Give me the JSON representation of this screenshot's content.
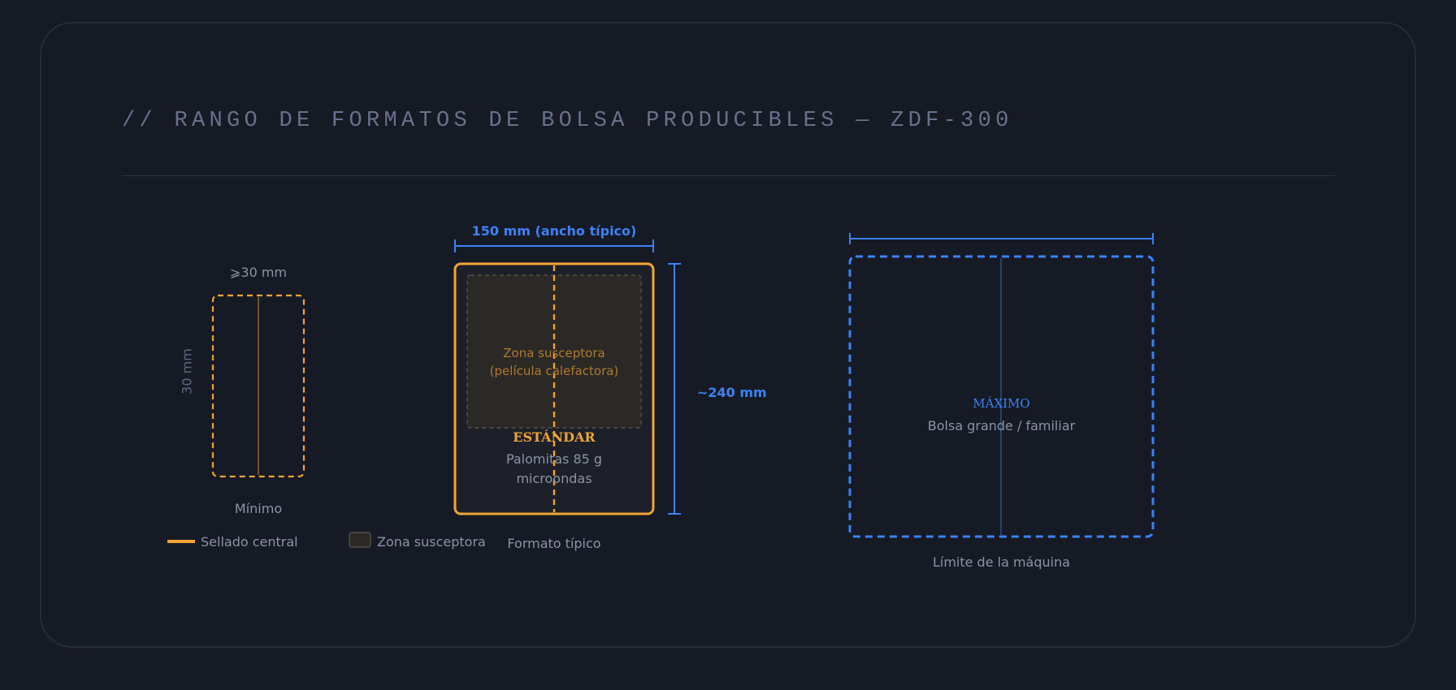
{
  "title": "// RANGO DE FORMATOS DE BOLSA PRODUCIBLES — ZDF-300",
  "minimum": {
    "width_label": "⩾30 mm",
    "height_label": "30 mm",
    "caption": "Mínimo"
  },
  "standard": {
    "width_label": "150 mm (ancho típico)",
    "height_label": "~240 mm",
    "zone_line1": "Zona susceptora",
    "zone_line2": "(película calefactora)",
    "tag": "ESTÁNDAR",
    "desc_line1": "Palomitas 85 g",
    "desc_line2": "microondas",
    "caption": "Formato típico"
  },
  "maximum": {
    "tag": "MÁXIMO",
    "desc": "Bolsa grande / familiar",
    "caption": "Límite de la máquina"
  },
  "legend": {
    "seal": "Sellado central",
    "zone": "Zona susceptora"
  },
  "colors": {
    "background": "#161a25",
    "orange": "#f0a534",
    "blue": "#3b82f6",
    "text_muted": "#8b93a7"
  }
}
